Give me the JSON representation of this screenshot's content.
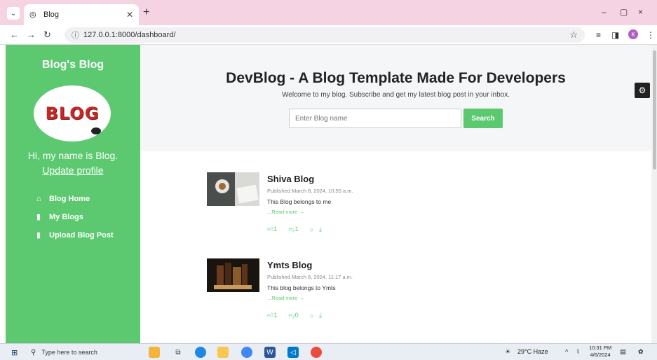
{
  "browser": {
    "tab_title": "Blog",
    "url": "127.0.0.1:8000/dashboard/",
    "profile_initial": "K",
    "new_tab_icon": "plus-icon",
    "window_controls": [
      "–",
      "▢",
      "×"
    ]
  },
  "sidebar": {
    "blog_name": "Blog's Blog",
    "logo_text": "BLOG",
    "intro": "Hi, my name is Blog.",
    "update_link": "Update profile",
    "items": [
      {
        "label": "Blog Home",
        "icon": "home-icon"
      },
      {
        "label": "My Blogs",
        "icon": "bookmark-icon"
      },
      {
        "label": "Upload Blog Post",
        "icon": "bookmark-icon"
      }
    ]
  },
  "hero": {
    "title": "DevBlog - A Blog Template Made For Developers",
    "subtitle": "Welcome to my blog. Subscribe and get my latest blog post in your inbox.",
    "search_placeholder": "Enter Blog name",
    "search_button": "Search"
  },
  "posts": [
    {
      "title": "Shiva Blog",
      "published": "Published March 8, 2024, 10:55 a.m.",
      "description": "This Blog belongs to me",
      "read_more": "...Read more →",
      "likes": "1",
      "dislikes": "1"
    },
    {
      "title": "Ymts Blog",
      "published": "Published March 8, 2024, 11:17 a.m.",
      "description": "This blog belongs to Ymts",
      "read_more": "...Read more →",
      "likes": "1",
      "dislikes": "0"
    }
  ],
  "taskbar": {
    "search_placeholder": "Type here to search",
    "weather": "29°C  Haze",
    "time": "10:31 PM",
    "date": "4/6/2024"
  },
  "colors": {
    "accent": "#5cc971",
    "titlebar": "#f6d3e3"
  }
}
